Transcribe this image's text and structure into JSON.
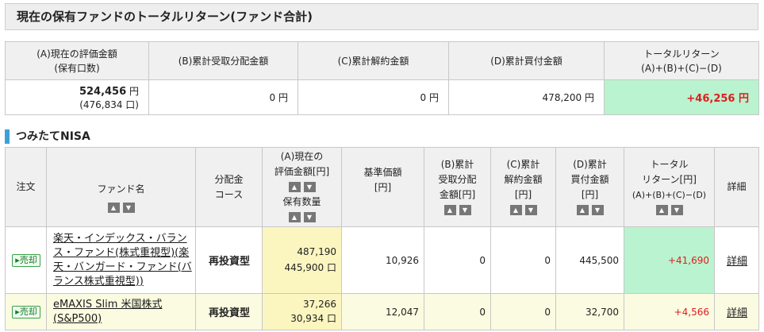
{
  "title": "現在の保有ファンドのトータルリターン(ファンド合計)",
  "summary": {
    "headers": {
      "a1": "(A)現在の評価金額",
      "a2": "(保有口数)",
      "b": "(B)累計受取分配金額",
      "c": "(C)累計解約金額",
      "d": "(D)累計買付金額",
      "tr1": "トータルリターン",
      "tr2": "(A)+(B)+(C)−(D)"
    },
    "a_value": "524,456",
    "yen": "円",
    "a_units": "(476,834 口)",
    "b_value": "0 円",
    "c_value": "0 円",
    "d_value": "478,200 円",
    "tr_value": "+46,256 円"
  },
  "section": {
    "title": "つみたてNISA"
  },
  "funds_table": {
    "headers": {
      "order": "注文",
      "fund_name": "ファンド名",
      "course1": "分配金",
      "course2": "コース",
      "eval1": "(A)現在の",
      "eval2": "評価金額[円]",
      "eval3": "保有数量",
      "nav1": "基準価額",
      "nav2": "[円]",
      "dist1": "(B)累計",
      "dist2": "受取分配",
      "dist3": "金額[円]",
      "redeem1": "(C)累計",
      "redeem2": "解約金額",
      "redeem3": "[円]",
      "buy1": "(D)累計",
      "buy2": "買付金額",
      "buy3": "[円]",
      "tr1": "トータル",
      "tr2": "リターン[円]",
      "tr3": "(A)+(B)+(C)−(D)",
      "detail": "詳細"
    },
    "sort_up": "▲",
    "sort_down": "▼",
    "rows": [
      {
        "order_button": "▸売却",
        "fund_name": "楽天・インデックス・バランス・ファンド(株式重視型)(楽天・バンガード・ファンド(バランス株式重視型))",
        "course": "再投資型",
        "eval_amount": "487,190",
        "units": "445,900 口",
        "nav": "10,926",
        "distribution": "0",
        "redeemed": "0",
        "bought": "445,500",
        "total_return": "+41,690",
        "detail": "詳細"
      },
      {
        "order_button": "▸売却",
        "fund_name": "eMAXIS Slim 米国株式(S&P500)",
        "course": "再投資型",
        "eval_amount": "37,266",
        "units": "30,934 口",
        "nav": "12,047",
        "distribution": "0",
        "redeemed": "0",
        "bought": "32,700",
        "total_return": "+4,566",
        "detail": "詳細"
      }
    ]
  }
}
